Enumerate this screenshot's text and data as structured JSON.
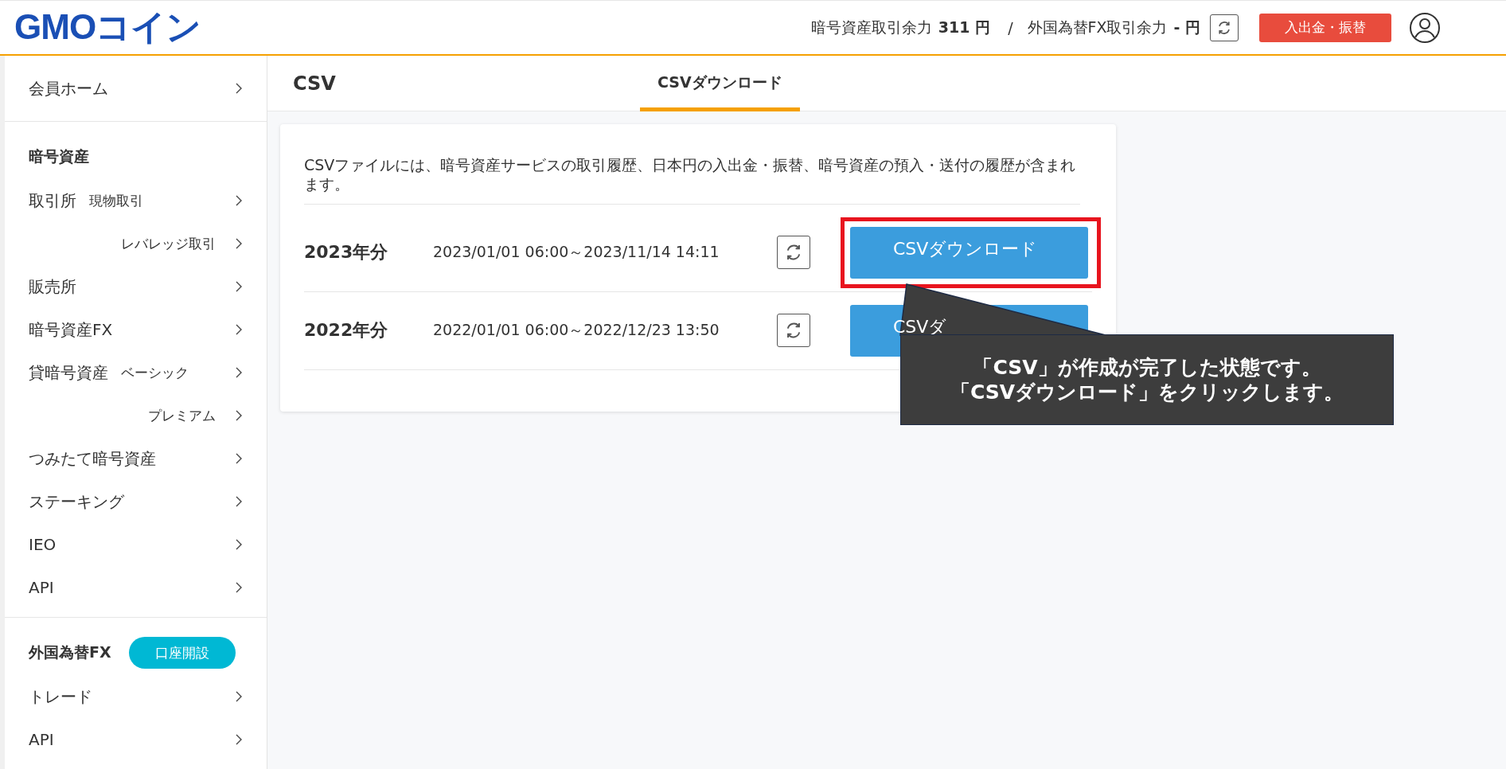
{
  "header": {
    "logo": "GMOコイン",
    "balances": [
      {
        "label": "暗号資産取引余力",
        "value": "311 円"
      },
      {
        "label": "外国為替FX取引余力",
        "value": "- 円"
      }
    ],
    "separator": "/",
    "deposit_button": "入出金・振替"
  },
  "sidebar": {
    "sections": [
      {
        "items": [
          {
            "label": "会員ホーム"
          }
        ]
      },
      {
        "heading": "暗号資産",
        "items": [
          {
            "label": "取引所",
            "sub": "現物取引"
          },
          {
            "sub": "レバレッジ取引"
          },
          {
            "label": "販売所"
          },
          {
            "label": "暗号資産FX"
          },
          {
            "label": "貸暗号資産",
            "sub": "ベーシック"
          },
          {
            "sub": "プレミアム"
          },
          {
            "label": "つみたて暗号資産"
          },
          {
            "label": "ステーキング"
          },
          {
            "label": "IEO"
          },
          {
            "label": "API"
          }
        ]
      },
      {
        "heading": "外国為替FX",
        "badge": "口座開設",
        "items": [
          {
            "label": "トレード"
          },
          {
            "label": "API"
          }
        ]
      }
    ]
  },
  "page": {
    "title": "CSV",
    "tabs": [
      {
        "label": "CSVダウンロード",
        "selected": true
      }
    ]
  },
  "card": {
    "description": "CSVファイルには、暗号資産サービスの取引履歴、日本円の入出金・振替、暗号資産の預入・送付の履歴が含まれます。",
    "rows": [
      {
        "year": "2023年分",
        "range": "2023/01/01 06:00～2023/11/14 14:11",
        "button": "CSVダウンロード",
        "highlighted": true
      },
      {
        "year": "2022年分",
        "range": "2022/01/01 06:00～2022/12/23 13:50",
        "button": "CSVダ",
        "highlighted": false
      }
    ]
  },
  "callout": {
    "lines": [
      "「CSV」が作成が完了した状態です。",
      "「CSVダウンロード」をクリックします。"
    ]
  }
}
